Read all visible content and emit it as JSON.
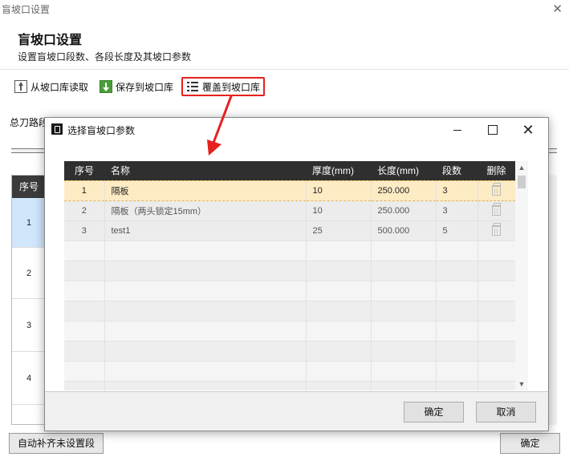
{
  "outer": {
    "title": "盲坡口设置",
    "header_title": "盲坡口设置",
    "header_subtitle": "设置盲坡口段数、各段长度及其坡口参数",
    "close_glyph": "✕",
    "toolbar": {
      "read_label": "从坡口库读取",
      "save_label": "保存到坡口库",
      "overwrite_label": "覆盖到坡口库"
    },
    "total_label": "总刀路段数",
    "grid_header": "序号",
    "rows": [
      "1",
      "2",
      "3",
      "4"
    ],
    "auto_fill_label": "自动补齐未设置段",
    "ok_label": "确定"
  },
  "dialog": {
    "title": "选择盲坡口参数",
    "columns": [
      "序号",
      "名称",
      "厚度(mm)",
      "长度(mm)",
      "段数",
      "删除"
    ],
    "rows": [
      {
        "index": "1",
        "name": "隔板",
        "thickness": "10",
        "length": "250.000",
        "segments": "3",
        "selected": true
      },
      {
        "index": "2",
        "name": "隔板（两头锁定15mm）",
        "thickness": "10",
        "length": "250.000",
        "segments": "3",
        "selected": false
      },
      {
        "index": "3",
        "name": "test1",
        "thickness": "25",
        "length": "500.000",
        "segments": "5",
        "selected": false
      }
    ],
    "ok_label": "确定",
    "cancel_label": "取消"
  },
  "colors": {
    "highlight": "#e62020",
    "selected_row": "#fdebc4",
    "header_dark": "#2f2f2f"
  }
}
